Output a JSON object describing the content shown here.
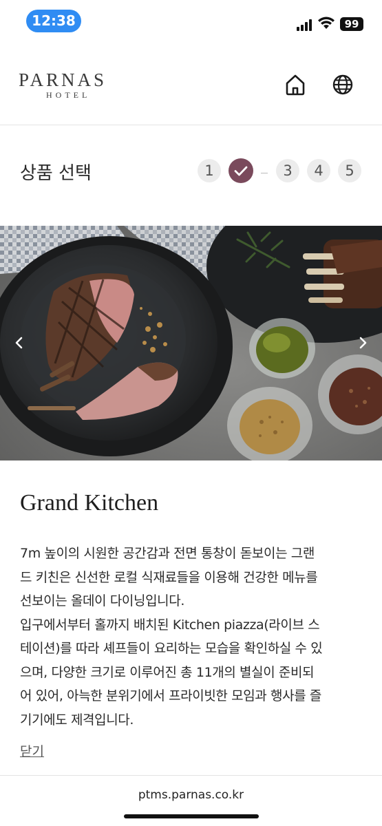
{
  "status_bar": {
    "time": "12:38",
    "battery": "99"
  },
  "header": {
    "logo_main": "PARNAS",
    "logo_sub": "HOTEL",
    "icons": [
      "home-icon",
      "globe-icon"
    ]
  },
  "booking": {
    "step_title": "상품 선택",
    "steps": [
      {
        "label": "1",
        "state": "default"
      },
      {
        "label": "✓",
        "state": "active"
      },
      {
        "label": "3",
        "state": "default"
      },
      {
        "label": "4",
        "state": "default"
      },
      {
        "label": "5",
        "state": "default"
      }
    ]
  },
  "venue": {
    "name": "Grand Kitchen",
    "description_lines": [
      "7m 높이의 시원한 공간감과 전면 통창이 돋보이는 그랜",
      "드 키친은 신선한 로컬 식재료들을 이용해 건강한 메뉴를",
      "선보이는 올데이 다이닝입니다.",
      "입구에서부터 홀까지 배치된 Kitchen piazza(라이브 스",
      "테이션)를 따라 셰프들이 요리하는 모습을 확인하실 수 있",
      "으며, 다양한 크기로 이루어진 총 11개의 별실이 준비되",
      "어 있어, 아늑한 분위기에서 프라이빗한 모임과 행사를 즐",
      "기기에도 제격입니다."
    ],
    "close_label": "닫기"
  },
  "browser": {
    "url": "ptms.parnas.co.kr"
  },
  "colors": {
    "accent": "#7a4a5c",
    "status_pill": "#2f8cf3"
  }
}
